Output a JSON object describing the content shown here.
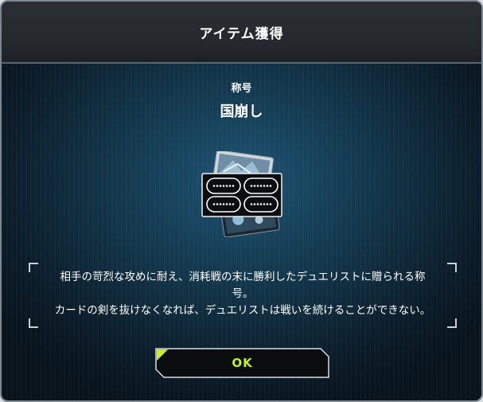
{
  "dialog": {
    "title": "アイテム獲得",
    "item_kind": "称号",
    "item_name": "国崩し",
    "item_icon": "title-plate-icon",
    "description": "相手の苛烈な攻めに耐え、消耗戦の末に勝利したデュエリストに贈られる称\n号。\nカードの剣を抜けなくなれば、デュエリストは戦いを続けることができない。",
    "ok_label": "OK"
  },
  "colors": {
    "accent": "#c8f01e",
    "header_bg": "#2b2f33",
    "panel_bg": "#123549",
    "text": "#ffffff"
  }
}
